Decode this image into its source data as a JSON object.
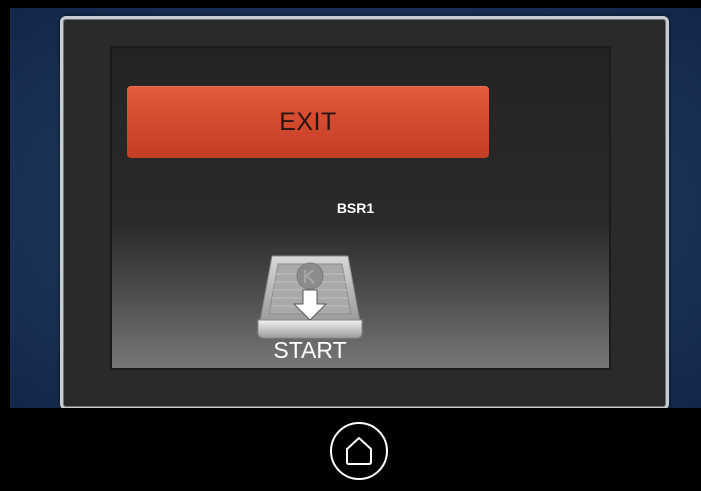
{
  "dialog": {
    "exit_label": "EXIT",
    "device_name": "BSR1",
    "start_label": "START",
    "start_icon": "tray-download-icon"
  },
  "navbar": {
    "home_icon": "home-icon"
  },
  "colors": {
    "background": "#1c3459",
    "exit_button": "#d34a2e",
    "text": "#ffffff"
  }
}
